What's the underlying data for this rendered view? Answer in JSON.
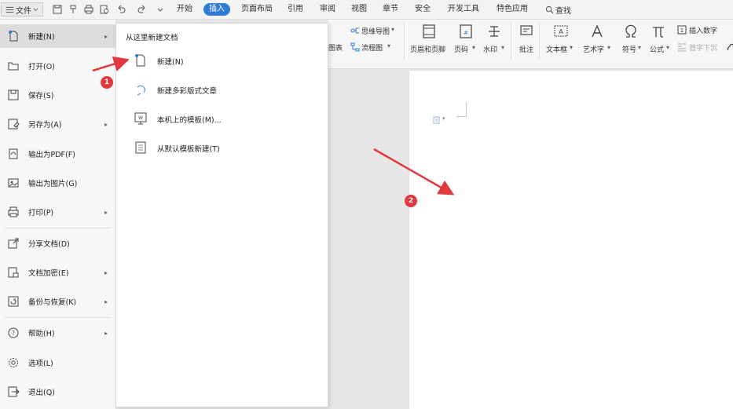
{
  "file_menu_button": "文件",
  "tabs": [
    "开始",
    "插入",
    "页面布局",
    "引用",
    "审阅",
    "视图",
    "章节",
    "安全",
    "开发工具",
    "特色应用"
  ],
  "active_tab": "插入",
  "search_label": "查找",
  "ribbon": {
    "mindmap": "思维导图",
    "chart_partial": "图表",
    "flowchart": "流程图",
    "header_footer": "页眉和页脚",
    "page_number": "页码",
    "watermark": "水印",
    "comment": "批注",
    "textbox": "文本框",
    "wordart": "艺术字",
    "symbol": "符号",
    "formula": "公式",
    "insert_number": "插入数字",
    "drop_cap": "首字下沉"
  },
  "left_menu": [
    {
      "label": "新建(N)",
      "arrow": true,
      "icon": "new-file-icon"
    },
    {
      "label": "打开(O)",
      "arrow": false,
      "icon": "folder-icon"
    },
    {
      "label": "保存(S)",
      "arrow": false,
      "icon": "save-icon"
    },
    {
      "label": "另存为(A)",
      "arrow": true,
      "icon": "save-as-icon"
    },
    {
      "label": "输出为PDF(F)",
      "arrow": false,
      "icon": "pdf-icon"
    },
    {
      "label": "输出为图片(G)",
      "arrow": false,
      "icon": "image-icon"
    },
    {
      "label": "打印(P)",
      "arrow": true,
      "icon": "print-icon"
    },
    {
      "label": "分享文档(D)",
      "arrow": false,
      "icon": "share-icon"
    },
    {
      "label": "文档加密(E)",
      "arrow": true,
      "icon": "lock-icon"
    },
    {
      "label": "备份与恢复(K)",
      "arrow": true,
      "icon": "backup-icon"
    },
    {
      "label": "帮助(H)",
      "arrow": true,
      "icon": "help-icon"
    },
    {
      "label": "选项(L)",
      "arrow": false,
      "icon": "gear-icon"
    },
    {
      "label": "退出(Q)",
      "arrow": false,
      "icon": "exit-icon"
    }
  ],
  "submenu": {
    "header": "从这里新建文档",
    "items": [
      {
        "label": "新建(N)",
        "icon": "blank-document-icon"
      },
      {
        "label": "新建多彩版式文章",
        "icon": "colorful-layout-icon"
      },
      {
        "label": "本机上的模板(M)...",
        "icon": "local-template-icon"
      },
      {
        "label": "从默认模板新建(T)",
        "icon": "default-template-icon"
      }
    ]
  },
  "annotations": [
    "1",
    "2"
  ],
  "colors": {
    "accent": "#2f7bd6",
    "annotation": "#e0393e"
  }
}
